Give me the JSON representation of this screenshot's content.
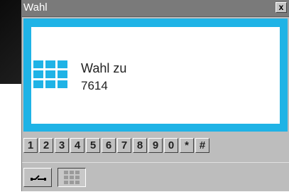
{
  "window": {
    "title": "Wahl",
    "close_label": "x"
  },
  "display": {
    "icon": "keypad-grid-icon",
    "line1": "Wahl zu",
    "line2": "7614",
    "accent_color": "#1fb3e6"
  },
  "keypad": {
    "keys": [
      "1",
      "2",
      "3",
      "4",
      "5",
      "6",
      "7",
      "8",
      "9",
      "0",
      "*",
      "#"
    ]
  },
  "toolbar": {
    "buttons": [
      {
        "icon": "hangup-icon",
        "active": false
      },
      {
        "icon": "keypad-icon",
        "active": true
      }
    ]
  }
}
